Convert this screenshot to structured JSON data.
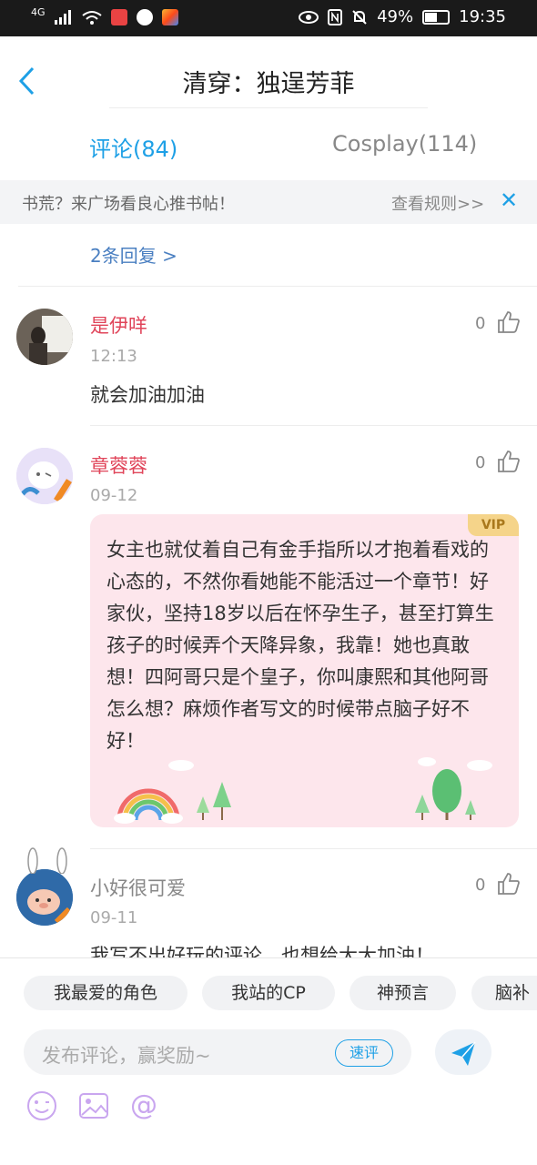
{
  "status_bar": {
    "network": "4G",
    "battery_percent": "49%",
    "battery_level": 0.49,
    "time": "19:35"
  },
  "header": {
    "title": "清穿：独逞芳菲"
  },
  "tabs": [
    {
      "label": "评论(84)",
      "active": true
    },
    {
      "label": "Cosplay(114)",
      "active": false
    }
  ],
  "notice": {
    "text": "书荒？来广场看良心推书帖！",
    "rules_link": "查看规则>>"
  },
  "replies_link": "2条回复 >",
  "comments": [
    {
      "username": "是伊咩",
      "time": "12:13",
      "likes": "0",
      "text": "就会加油加油",
      "username_color": "#e0455a"
    },
    {
      "username": "章蓉蓉",
      "time": "09-12",
      "likes": "0",
      "vip": "VIP",
      "text": "女主也就仗着自己有金手指所以才抱着看戏的心态的，不然你看她能不能活过一个章节！好家伙，坚持18岁以后在怀孕生子，甚至打算生孩子的时候弄个天降异象，我靠！她也真敢想！四阿哥只是个皇子，你叫康熙和其他阿哥怎么想？麻烦作者写文的时候带点脑子好不好！",
      "username_color": "#e0455a"
    },
    {
      "username": "小好很可爱",
      "time": "09-11",
      "likes": "0",
      "text": "我写不出好玩的评论，也想给大大加油！",
      "username_color": "#888888"
    }
  ],
  "bottom": {
    "chips": [
      "我最爱的角色",
      "我站的CP",
      "神预言",
      "脑补"
    ],
    "input_placeholder": "发布评论，赢奖励~",
    "quick_comment": "速评"
  },
  "colors": {
    "accent": "#1ea0e6",
    "vip_bg": "#fde6ec"
  }
}
